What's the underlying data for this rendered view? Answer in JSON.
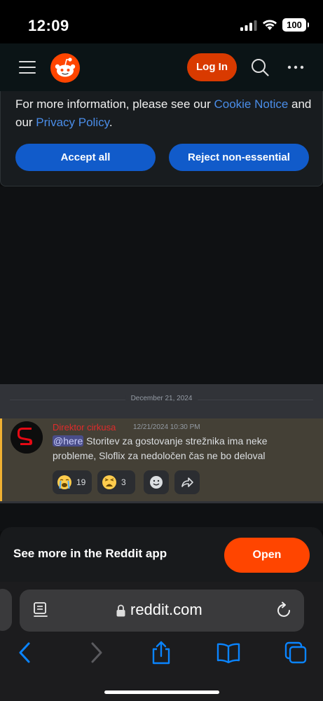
{
  "status_bar": {
    "time": "12:09",
    "battery": "100",
    "icons": [
      "signal-icon",
      "wifi-icon",
      "battery-icon"
    ]
  },
  "header": {
    "login_label": "Log In",
    "icons": [
      "menu-icon",
      "reddit-logo",
      "search-icon",
      "more-icon"
    ],
    "brand_color": "#ff4500",
    "login_color": "#d93a00"
  },
  "cookie_banner": {
    "text_prefix": "For more information, please see our ",
    "cookie_link": "Cookie Notice",
    "text_middle": " and our ",
    "privacy_link": "Privacy Policy",
    "text_suffix": ".",
    "accept_label": "Accept all",
    "reject_label": "Reject non-essential",
    "link_color": "#4a8de8",
    "button_color": "#115bca"
  },
  "discord_embed": {
    "date": "December 21, 2024",
    "author": "Direktor cirkusa",
    "timestamp": "12/21/2024 10:30 PM",
    "mention": "@here",
    "message": " Storitev za gostovanje strežnika ima neke probleme, Sloflix za nedoločen čas ne bo deloval",
    "reactions": [
      {
        "emoji": "crying-face-icon",
        "count": "19"
      },
      {
        "emoji": "weary-face-icon",
        "count": "3"
      }
    ],
    "author_color": "#e02b2b",
    "highlight_color": "#f0b132"
  },
  "app_banner": {
    "text": "See more in the Reddit app",
    "open_label": "Open",
    "open_color": "#ff4500"
  },
  "safari": {
    "url": "reddit.com",
    "icons": [
      "page-menu-icon",
      "lock-icon",
      "reload-icon",
      "back-icon",
      "forward-icon",
      "share-icon",
      "bookmarks-icon",
      "tabs-icon"
    ]
  }
}
